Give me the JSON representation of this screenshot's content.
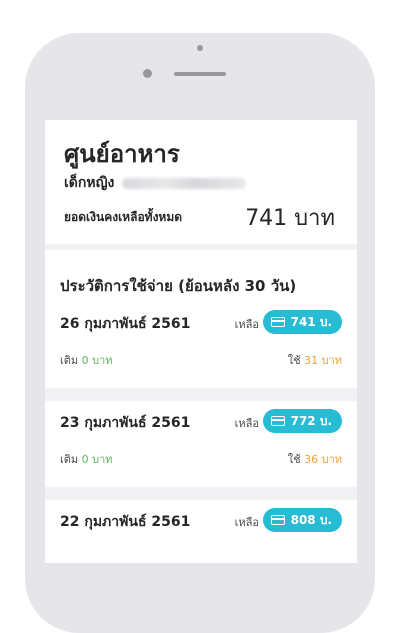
{
  "header": {
    "store_name": "ศูนย์อาหาร",
    "kid_label": "เด็กหญิง",
    "balance_label": "ยอดเงินคงเหลือทั้งหมด",
    "balance_value": "741 บาท"
  },
  "history": {
    "title": "ประวัติการใช้จ่าย (ย้อนหลัง 30 วัน)",
    "remain_label": "เหลือ",
    "topup_label": "เติม",
    "spend_label": "ใช้",
    "entries": [
      {
        "date": "26 กุมภาพันธ์ 2561",
        "remain": "741 บ.",
        "topup": "0 บาท",
        "spend": "31 บาท"
      },
      {
        "date": "23 กุมภาพันธ์ 2561",
        "remain": "772 บ.",
        "topup": "0 บาท",
        "spend": "36 บาท"
      },
      {
        "date": "22 กุมภาพันธ์ 2561",
        "remain": "808 บ."
      }
    ]
  },
  "colors": {
    "pill": "#27bcd4",
    "topup": "#5cb85c",
    "spend": "#f0a030"
  }
}
